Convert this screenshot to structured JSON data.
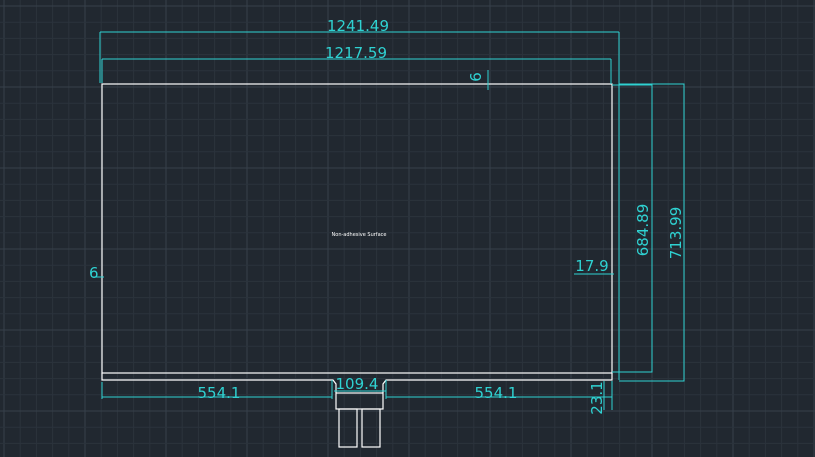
{
  "drawing": {
    "colors": {
      "background": "#212830",
      "grid_minor": "#2b333c",
      "grid_major": "#36404a",
      "outline": "#ffffff",
      "dimension": "#2fd2d2"
    },
    "label": "Non-adhesive Surface",
    "dimensions": {
      "overall_width": "1241.49",
      "inner_width": "1217.59",
      "top_offset": "6",
      "left_offset": "6",
      "right_margin": "17.9",
      "inner_height": "684.89",
      "overall_height": "713.99",
      "left_tab_span": "554.1",
      "tail_width": "109.4",
      "right_tab_span": "554.1",
      "bottom_offset": "23.1"
    }
  }
}
